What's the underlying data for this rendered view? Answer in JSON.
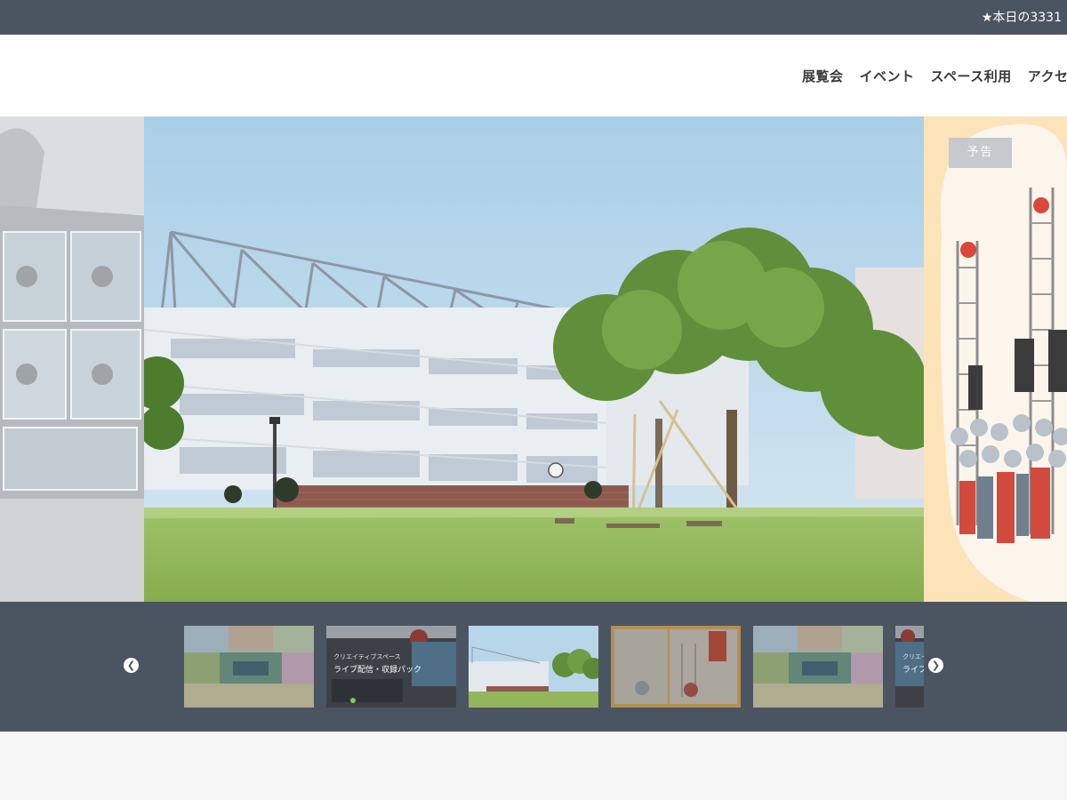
{
  "topbar": {
    "notice": "★本日の3331"
  },
  "nav": {
    "items": [
      "展覧会",
      "イベント",
      "スペース利用",
      "アクセ"
    ]
  },
  "hero": {
    "right_badge": "予告"
  },
  "thumbnails": [
    {
      "caption_small": "",
      "caption": ""
    },
    {
      "caption_small": "クリエイティブスペース",
      "caption": "ライブ配信・収録パック"
    },
    {
      "caption_small": "",
      "caption": ""
    },
    {
      "caption_small": "",
      "caption": ""
    },
    {
      "caption_small": "",
      "caption": ""
    },
    {
      "caption_small": "クリエイティ",
      "caption": "ライブ"
    }
  ],
  "colors": {
    "bar": "#4b5561",
    "header_bg": "#ffffff",
    "badge_bg": "#c6c9cd",
    "right_slide_bg": "#fde3b8"
  },
  "icons": {
    "prev": "chevron-left-icon",
    "next": "chevron-right-icon"
  }
}
